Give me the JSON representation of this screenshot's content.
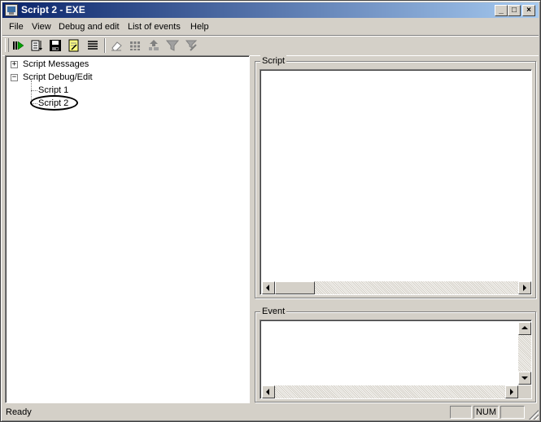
{
  "window": {
    "title": "Script 2 - EXE",
    "buttons": {
      "minimize": "_",
      "maximize": "□",
      "close": "×"
    }
  },
  "menu": [
    "File",
    "View",
    "Debug and edit",
    "List of events",
    "Help"
  ],
  "toolbar": {
    "icons": [
      "run-icon",
      "step-list-icon",
      "save-icon",
      "edit-document-icon",
      "list-icon",
      "eraser-icon",
      "grid-icon",
      "event-up-icon",
      "funnel-icon",
      "event-edit-icon"
    ]
  },
  "tree": {
    "items": [
      {
        "label": "Script Messages",
        "expander": "+"
      },
      {
        "label": "Script Debug/Edit",
        "expander": "−"
      },
      {
        "label": "Script 1"
      },
      {
        "label": "Script 2"
      }
    ]
  },
  "script_panel": {
    "label": "Script"
  },
  "event_panel": {
    "label": "Event"
  },
  "status": {
    "text": "Ready",
    "panels": [
      "",
      "NUM",
      ""
    ]
  }
}
